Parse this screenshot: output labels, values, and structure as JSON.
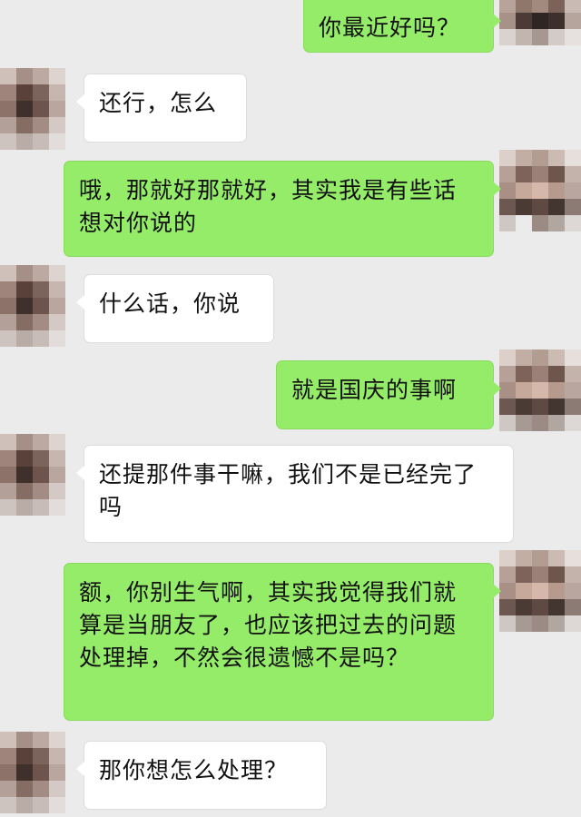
{
  "chat": {
    "messages": [
      {
        "side": "right",
        "text": "你最近好吗？",
        "avatar": "user-self"
      },
      {
        "side": "left",
        "text": "还行，怎么",
        "avatar": "user-other"
      },
      {
        "side": "right",
        "text": "哦，那就好那就好，其实我是有些话想对你说的",
        "avatar": "user-self"
      },
      {
        "side": "left",
        "text": "什么话，你说",
        "avatar": "user-other"
      },
      {
        "side": "right",
        "text": "就是国庆的事啊",
        "avatar": "user-self"
      },
      {
        "side": "left",
        "text": "还提那件事干嘛，我们不是已经完了吗",
        "avatar": "user-other"
      },
      {
        "side": "right",
        "text": "额，你别生气啊，其实我觉得我们就算是当朋友了，也应该把过去的问题处理掉，不然会很遗憾不是吗？",
        "avatar": "user-self"
      },
      {
        "side": "left",
        "text": "那你想怎么处理？",
        "avatar": "user-other"
      }
    ]
  },
  "colors": {
    "background": "#ebebeb",
    "sent_bubble": "#95ec69",
    "received_bubble": "#ffffff",
    "text": "#111111"
  }
}
